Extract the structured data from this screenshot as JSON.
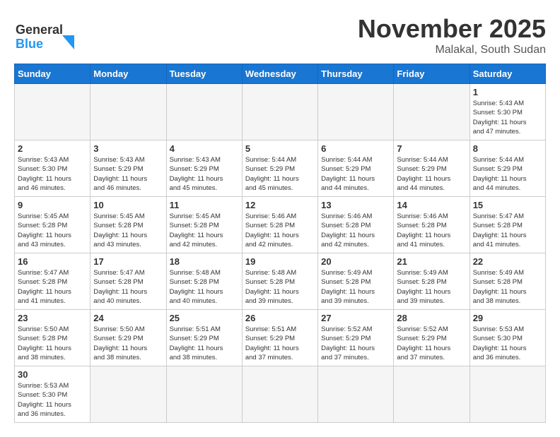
{
  "header": {
    "logo_general": "General",
    "logo_blue": "Blue",
    "month_title": "November 2025",
    "location": "Malakal, South Sudan"
  },
  "weekdays": [
    "Sunday",
    "Monday",
    "Tuesday",
    "Wednesday",
    "Thursday",
    "Friday",
    "Saturday"
  ],
  "days": [
    {
      "date": "",
      "info": ""
    },
    {
      "date": "",
      "info": ""
    },
    {
      "date": "",
      "info": ""
    },
    {
      "date": "",
      "info": ""
    },
    {
      "date": "",
      "info": ""
    },
    {
      "date": "",
      "info": ""
    },
    {
      "date": "1",
      "info": "Sunrise: 5:43 AM\nSunset: 5:30 PM\nDaylight: 11 hours\nand 47 minutes."
    },
    {
      "date": "2",
      "info": "Sunrise: 5:43 AM\nSunset: 5:30 PM\nDaylight: 11 hours\nand 46 minutes."
    },
    {
      "date": "3",
      "info": "Sunrise: 5:43 AM\nSunset: 5:29 PM\nDaylight: 11 hours\nand 46 minutes."
    },
    {
      "date": "4",
      "info": "Sunrise: 5:43 AM\nSunset: 5:29 PM\nDaylight: 11 hours\nand 45 minutes."
    },
    {
      "date": "5",
      "info": "Sunrise: 5:44 AM\nSunset: 5:29 PM\nDaylight: 11 hours\nand 45 minutes."
    },
    {
      "date": "6",
      "info": "Sunrise: 5:44 AM\nSunset: 5:29 PM\nDaylight: 11 hours\nand 44 minutes."
    },
    {
      "date": "7",
      "info": "Sunrise: 5:44 AM\nSunset: 5:29 PM\nDaylight: 11 hours\nand 44 minutes."
    },
    {
      "date": "8",
      "info": "Sunrise: 5:44 AM\nSunset: 5:29 PM\nDaylight: 11 hours\nand 44 minutes."
    },
    {
      "date": "9",
      "info": "Sunrise: 5:45 AM\nSunset: 5:28 PM\nDaylight: 11 hours\nand 43 minutes."
    },
    {
      "date": "10",
      "info": "Sunrise: 5:45 AM\nSunset: 5:28 PM\nDaylight: 11 hours\nand 43 minutes."
    },
    {
      "date": "11",
      "info": "Sunrise: 5:45 AM\nSunset: 5:28 PM\nDaylight: 11 hours\nand 42 minutes."
    },
    {
      "date": "12",
      "info": "Sunrise: 5:46 AM\nSunset: 5:28 PM\nDaylight: 11 hours\nand 42 minutes."
    },
    {
      "date": "13",
      "info": "Sunrise: 5:46 AM\nSunset: 5:28 PM\nDaylight: 11 hours\nand 42 minutes."
    },
    {
      "date": "14",
      "info": "Sunrise: 5:46 AM\nSunset: 5:28 PM\nDaylight: 11 hours\nand 41 minutes."
    },
    {
      "date": "15",
      "info": "Sunrise: 5:47 AM\nSunset: 5:28 PM\nDaylight: 11 hours\nand 41 minutes."
    },
    {
      "date": "16",
      "info": "Sunrise: 5:47 AM\nSunset: 5:28 PM\nDaylight: 11 hours\nand 41 minutes."
    },
    {
      "date": "17",
      "info": "Sunrise: 5:47 AM\nSunset: 5:28 PM\nDaylight: 11 hours\nand 40 minutes."
    },
    {
      "date": "18",
      "info": "Sunrise: 5:48 AM\nSunset: 5:28 PM\nDaylight: 11 hours\nand 40 minutes."
    },
    {
      "date": "19",
      "info": "Sunrise: 5:48 AM\nSunset: 5:28 PM\nDaylight: 11 hours\nand 39 minutes."
    },
    {
      "date": "20",
      "info": "Sunrise: 5:49 AM\nSunset: 5:28 PM\nDaylight: 11 hours\nand 39 minutes."
    },
    {
      "date": "21",
      "info": "Sunrise: 5:49 AM\nSunset: 5:28 PM\nDaylight: 11 hours\nand 39 minutes."
    },
    {
      "date": "22",
      "info": "Sunrise: 5:49 AM\nSunset: 5:28 PM\nDaylight: 11 hours\nand 38 minutes."
    },
    {
      "date": "23",
      "info": "Sunrise: 5:50 AM\nSunset: 5:28 PM\nDaylight: 11 hours\nand 38 minutes."
    },
    {
      "date": "24",
      "info": "Sunrise: 5:50 AM\nSunset: 5:29 PM\nDaylight: 11 hours\nand 38 minutes."
    },
    {
      "date": "25",
      "info": "Sunrise: 5:51 AM\nSunset: 5:29 PM\nDaylight: 11 hours\nand 38 minutes."
    },
    {
      "date": "26",
      "info": "Sunrise: 5:51 AM\nSunset: 5:29 PM\nDaylight: 11 hours\nand 37 minutes."
    },
    {
      "date": "27",
      "info": "Sunrise: 5:52 AM\nSunset: 5:29 PM\nDaylight: 11 hours\nand 37 minutes."
    },
    {
      "date": "28",
      "info": "Sunrise: 5:52 AM\nSunset: 5:29 PM\nDaylight: 11 hours\nand 37 minutes."
    },
    {
      "date": "29",
      "info": "Sunrise: 5:53 AM\nSunset: 5:30 PM\nDaylight: 11 hours\nand 36 minutes."
    },
    {
      "date": "30",
      "info": "Sunrise: 5:53 AM\nSunset: 5:30 PM\nDaylight: 11 hours\nand 36 minutes."
    },
    {
      "date": "",
      "info": ""
    },
    {
      "date": "",
      "info": ""
    },
    {
      "date": "",
      "info": ""
    },
    {
      "date": "",
      "info": ""
    },
    {
      "date": "",
      "info": ""
    },
    {
      "date": "",
      "info": ""
    }
  ]
}
